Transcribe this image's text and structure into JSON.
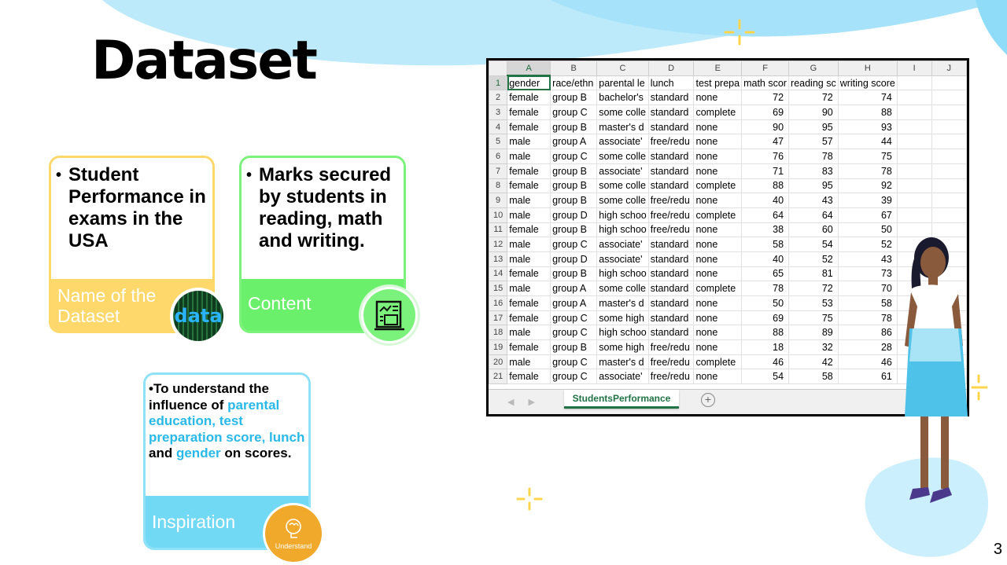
{
  "title": "Dataset",
  "cards": {
    "name": {
      "text": "Student Performance in exams in the USA",
      "footer": "Name of the Dataset",
      "badge": "data"
    },
    "content": {
      "text": "Marks secured by students in reading, math and writing.",
      "footer": "Content"
    },
    "inspiration": {
      "text_1": "To understand the influence of",
      "hl_1": "parental education, test preparation score, lunch",
      "text_2": "and",
      "hl_2": "gender",
      "text_3": "on scores.",
      "footer": "Inspiration",
      "badge": "Understand"
    }
  },
  "spreadsheet": {
    "columns": [
      "A",
      "B",
      "C",
      "D",
      "E",
      "F",
      "G",
      "H",
      "I",
      "J"
    ],
    "rows": [
      [
        "1",
        "gender",
        "race/ethn",
        "parental le",
        "lunch",
        "test prepa",
        "math scor",
        "reading sc",
        "writing score",
        "",
        ""
      ],
      [
        "2",
        "female",
        "group B",
        "bachelor's",
        "standard",
        "none",
        "72",
        "72",
        "74",
        "",
        ""
      ],
      [
        "3",
        "female",
        "group C",
        "some colle",
        "standard",
        "complete",
        "69",
        "90",
        "88",
        "",
        ""
      ],
      [
        "4",
        "female",
        "group B",
        "master's d",
        "standard",
        "none",
        "90",
        "95",
        "93",
        "",
        ""
      ],
      [
        "5",
        "male",
        "group A",
        "associate'",
        "free/redu",
        "none",
        "47",
        "57",
        "44",
        "",
        ""
      ],
      [
        "6",
        "male",
        "group C",
        "some colle",
        "standard",
        "none",
        "76",
        "78",
        "75",
        "",
        ""
      ],
      [
        "7",
        "female",
        "group B",
        "associate'",
        "standard",
        "none",
        "71",
        "83",
        "78",
        "",
        ""
      ],
      [
        "8",
        "female",
        "group B",
        "some colle",
        "standard",
        "complete",
        "88",
        "95",
        "92",
        "",
        ""
      ],
      [
        "9",
        "male",
        "group B",
        "some colle",
        "free/redu",
        "none",
        "40",
        "43",
        "39",
        "",
        ""
      ],
      [
        "10",
        "male",
        "group D",
        "high schoo",
        "free/redu",
        "complete",
        "64",
        "64",
        "67",
        "",
        ""
      ],
      [
        "11",
        "female",
        "group B",
        "high schoo",
        "free/redu",
        "none",
        "38",
        "60",
        "50",
        "",
        ""
      ],
      [
        "12",
        "male",
        "group C",
        "associate'",
        "standard",
        "none",
        "58",
        "54",
        "52",
        "",
        ""
      ],
      [
        "13",
        "male",
        "group D",
        "associate'",
        "standard",
        "none",
        "40",
        "52",
        "43",
        "",
        ""
      ],
      [
        "14",
        "female",
        "group B",
        "high schoo",
        "standard",
        "none",
        "65",
        "81",
        "73",
        "",
        ""
      ],
      [
        "15",
        "male",
        "group A",
        "some colle",
        "standard",
        "complete",
        "78",
        "72",
        "70",
        "",
        ""
      ],
      [
        "16",
        "female",
        "group A",
        "master's d",
        "standard",
        "none",
        "50",
        "53",
        "58",
        "",
        ""
      ],
      [
        "17",
        "female",
        "group C",
        "some high",
        "standard",
        "none",
        "69",
        "75",
        "78",
        "",
        ""
      ],
      [
        "18",
        "male",
        "group C",
        "high schoo",
        "standard",
        "none",
        "88",
        "89",
        "86",
        "",
        ""
      ],
      [
        "19",
        "female",
        "group B",
        "some high",
        "free/redu",
        "none",
        "18",
        "32",
        "28",
        "",
        ""
      ],
      [
        "20",
        "male",
        "group C",
        "master's d",
        "free/redu",
        "complete",
        "46",
        "42",
        "46",
        "",
        ""
      ],
      [
        "21",
        "female",
        "group C",
        "associate'",
        "free/redu",
        "none",
        "54",
        "58",
        "61",
        "",
        ""
      ]
    ],
    "sheet_tab": "StudentsPerformance",
    "add_sheet": "+"
  },
  "page_number": "3",
  "colors": {
    "yellow": "#ffd86b",
    "green": "#6bf06b",
    "blue": "#72d9f5",
    "highlight": "#28b9e8",
    "excel_green": "#217346"
  }
}
